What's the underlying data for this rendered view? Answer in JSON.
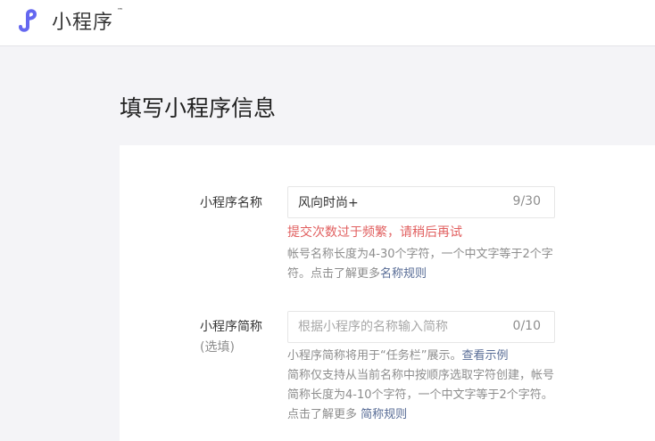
{
  "header": {
    "brand": "小程序",
    "trademark": "™"
  },
  "page": {
    "title": "填写小程序信息"
  },
  "form": {
    "name": {
      "label": "小程序名称",
      "value": "风向时尚+",
      "counter": "9/30",
      "error": "提交次数过于频繁，请稍后再试",
      "tip_text": "帐号名称长度为4-30个字符，一个中文字等于2个字符。点击了解更多",
      "tip_link": "名称规则"
    },
    "short_name": {
      "label": "小程序简称",
      "sublabel": "(选填)",
      "placeholder": "根据小程序的名称输入简称",
      "counter": "0/10",
      "tip_line1": "小程序简称将用于“任务栏”展示。",
      "tip_line1_link": "查看示例",
      "tip_line2": "简称仅支持从当前名称中按顺序选取字符创建，帐号简称长度为4-10个字符，一个中文字等于2个字符。点击了解更多 ",
      "tip_link": "简称规则"
    }
  },
  "colors": {
    "accent": "#6467f0",
    "error": "#e15f5f",
    "link": "#576b95"
  }
}
